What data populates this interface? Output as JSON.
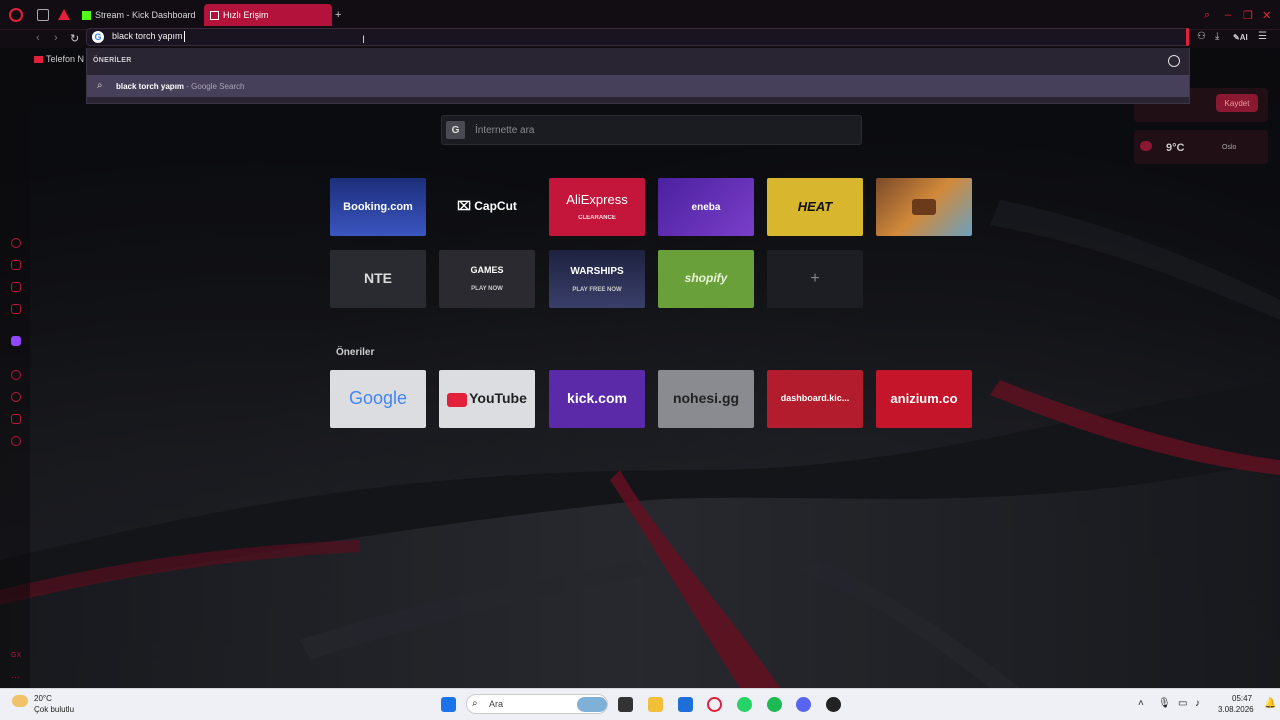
{
  "tabs": [
    {
      "label": "Stream - Kick Dashboard",
      "active": false
    },
    {
      "label": "Hızlı Erişim",
      "active": true
    }
  ],
  "address_bar": {
    "value": "black torch yapım"
  },
  "dropdown": {
    "section_label": "ÖNERİLER",
    "suggestion_text": "black torch yapım",
    "suggestion_sub": " - Google Search"
  },
  "bookmarks": [
    {
      "label": "Telefon N"
    }
  ],
  "page_search": {
    "placeholder": "İnternette ara"
  },
  "speed_dial": [
    {
      "label": "Booking.com",
      "bg": "#1c2f7a"
    },
    {
      "label": "CapCut",
      "bg": "transparent"
    },
    {
      "label": "AliExpress",
      "sub": "CLEARANCE",
      "bg": "#c4153b"
    },
    {
      "label": "eneba",
      "bg": "#5b2aa8"
    },
    {
      "label": "HEAT",
      "bg": "#d8b72e"
    },
    {
      "label": "",
      "bg": "#b06b2a"
    },
    {
      "label": "NTE",
      "bg": "#2a2b30"
    },
    {
      "label": "GAMES",
      "sub": "PLAY NOW",
      "bg": "#2a2a30"
    },
    {
      "label": "WARSHIPS",
      "sub": "PLAY FREE NOW",
      "bg": "#2b2f52"
    },
    {
      "label": "shopify",
      "bg": "#6aa03a"
    },
    {
      "label": "+",
      "bg": "#1d1e24"
    }
  ],
  "suggestions_title": "Öneriler",
  "suggestions": [
    {
      "label": "Google",
      "bg": "#dcdde0"
    },
    {
      "label": "YouTube",
      "bg": "#dcdde0"
    },
    {
      "label": "kick.com",
      "bg": "#5b2aa8"
    },
    {
      "label": "nohesi.gg",
      "bg": "#8a8b90"
    },
    {
      "label": "dashboard.kic...",
      "bg": "#b31c2c"
    },
    {
      "label": "anizium.co",
      "bg": "#c4152a"
    }
  ],
  "weather_widget": {
    "temp": "9°C",
    "city": "Oslo",
    "button": "Kaydet"
  },
  "taskbar": {
    "weather_temp": "20°C",
    "weather_desc": "Çok bulutlu",
    "search_placeholder": "Ara",
    "time": "05:47",
    "date": "3.08.2026"
  }
}
